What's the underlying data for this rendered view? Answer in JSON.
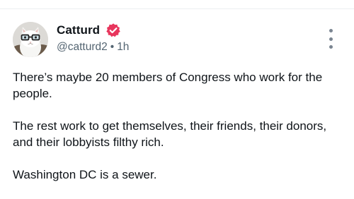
{
  "author": {
    "display_name": "Catturd",
    "handle": "@catturd2",
    "separator": "•",
    "timestamp": "1h",
    "avatar_icon": "cat-with-glasses-avatar",
    "verified_icon": "verified-badge-icon",
    "verified_color": "#e8365d"
  },
  "post": {
    "paragraphs": [
      "There’s maybe 20 members of Congress who work for the people.",
      "The rest work to get themselves, their friends, their donors, and their lobbyists filthy rich.",
      "Washington DC is a sewer."
    ]
  },
  "actions": {
    "more_icon": "vertical-dots-icon"
  },
  "colors": {
    "text": "#0f1419",
    "muted": "#536471",
    "divider": "#eceff1"
  }
}
